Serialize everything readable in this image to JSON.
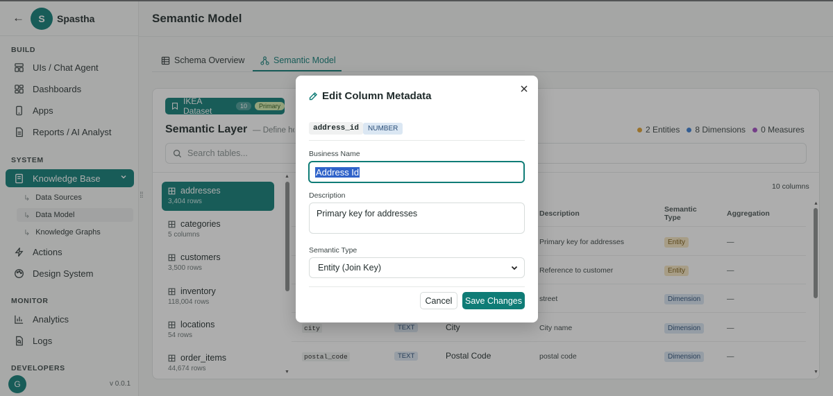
{
  "brand": {
    "initial": "S",
    "name": "Spastha"
  },
  "sidebar": {
    "sections": {
      "build": "BUILD",
      "system": "SYSTEM",
      "monitor": "MONITOR",
      "developers": "DEVELOPERS"
    },
    "build_items": [
      "UIs / Chat Agent",
      "Dashboards",
      "Apps",
      "Reports / AI Analyst"
    ],
    "knowledge_base": "Knowledge Base",
    "kb_sub": [
      "Data Sources",
      "Data Model",
      "Knowledge Graphs"
    ],
    "system_items": [
      "Actions",
      "Design System"
    ],
    "monitor_items": [
      "Analytics",
      "Logs"
    ],
    "user_initial": "G",
    "version": "v 0.0.1"
  },
  "header": {
    "title": "Semantic Model"
  },
  "tabs": [
    {
      "label": "Schema Overview"
    },
    {
      "label": "Semantic Model"
    }
  ],
  "dataset": {
    "name": "IKEA Dataset",
    "count": "10",
    "badge": "Primary"
  },
  "layer": {
    "title": "Semantic Layer",
    "subtitle": "— Define how",
    "stats": {
      "entities": "2 Entities",
      "dimensions": "8 Dimensions",
      "measures": "0 Measures"
    },
    "colors": {
      "entities": "#e0a030",
      "dimensions": "#3b7fd4",
      "measures": "#a34cc4"
    }
  },
  "search": {
    "placeholder": "Search tables..."
  },
  "tables": [
    {
      "name": "addresses",
      "meta": "3,404 rows"
    },
    {
      "name": "categories",
      "meta": "5 columns"
    },
    {
      "name": "customers",
      "meta": "3,500 rows"
    },
    {
      "name": "inventory",
      "meta": "118,004 rows"
    },
    {
      "name": "locations",
      "meta": "54 rows"
    },
    {
      "name": "order_items",
      "meta": "44,674 rows"
    }
  ],
  "columns_table": {
    "count": "10 columns",
    "headers": {
      "description": "Description",
      "semantic_type": "Semantic Type",
      "aggregation": "Aggregation"
    },
    "rows": [
      {
        "description": "Primary key for addresses",
        "semantic": "Entity",
        "aggregation": "—"
      },
      {
        "description": "Reference to customer",
        "semantic": "Entity",
        "aggregation": "—"
      },
      {
        "description": "street",
        "semantic": "Dimension",
        "aggregation": "—"
      },
      {
        "column": "city",
        "type": "TEXT",
        "business": "City",
        "description": "City name",
        "semantic": "Dimension",
        "aggregation": "—"
      },
      {
        "column": "postal_code",
        "type": "TEXT",
        "business": "Postal Code",
        "description": "postal code",
        "semantic": "Dimension",
        "aggregation": "—"
      }
    ]
  },
  "modal": {
    "title": "Edit Column Metadata",
    "column_name": "address_id",
    "column_type": "NUMBER",
    "business_name_label": "Business Name",
    "business_name_value": "Address Id",
    "description_label": "Description",
    "description_value": "Primary key for addresses",
    "semantic_type_label": "Semantic Type",
    "semantic_type_value": "Entity (Join Key)",
    "cancel_label": "Cancel",
    "save_label": "Save Changes"
  }
}
